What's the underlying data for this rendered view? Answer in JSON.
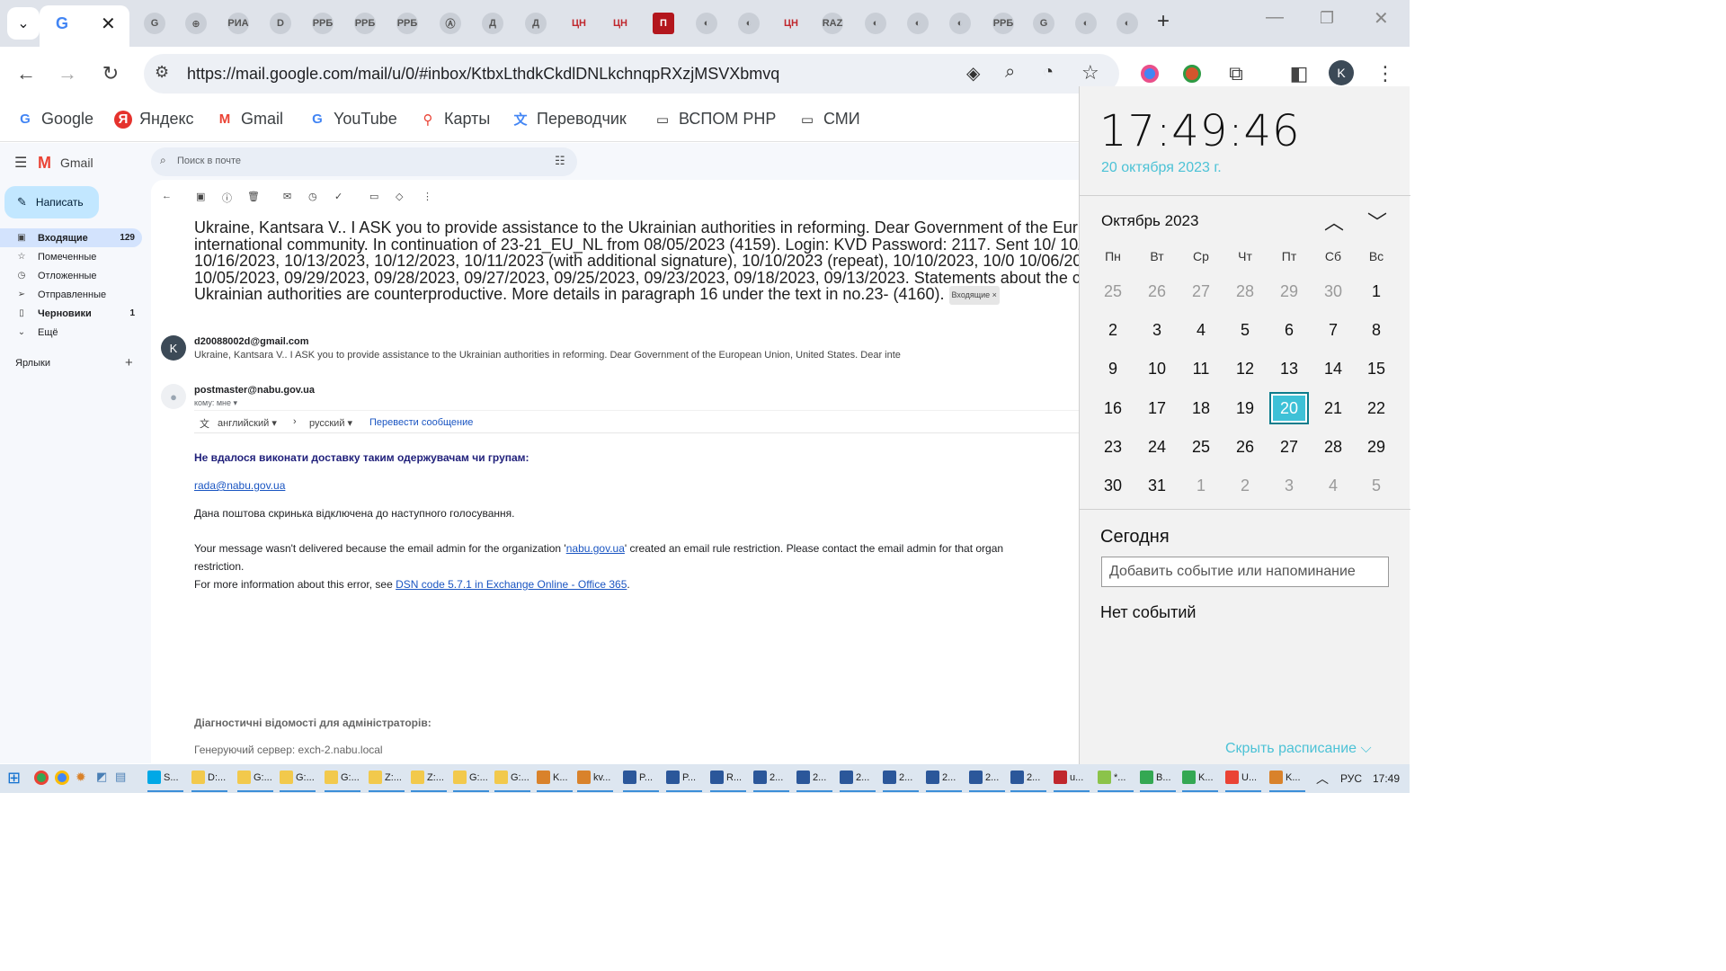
{
  "browser": {
    "tabs": [
      {
        "label": "G",
        "icon": "google-icon"
      },
      {
        "label": "G",
        "icon": "google-icon"
      },
      {
        "label": "⊕",
        "icon": "site-icon"
      },
      {
        "label": "РИА",
        "icon": "ria-icon"
      },
      {
        "label": "D",
        "icon": "d-icon"
      },
      {
        "label": "РРБ",
        "icon": "rrb-icon"
      },
      {
        "label": "РРБ",
        "icon": "rrb-icon"
      },
      {
        "label": "РРБ",
        "icon": "rrb-icon"
      },
      {
        "label": "Ⓐ",
        "icon": "a-icon"
      },
      {
        "label": "Д",
        "icon": "d-circle-icon"
      },
      {
        "label": "Д",
        "icon": "d-circle-icon"
      },
      {
        "label": "ЦН",
        "icon": "cn-icon"
      },
      {
        "label": "ЦН",
        "icon": "cn-icon"
      },
      {
        "label": "П",
        "icon": "p-icon"
      },
      {
        "label": "◐",
        "icon": "globe-icon"
      },
      {
        "label": "◐",
        "icon": "globe-icon"
      },
      {
        "label": "ЦН",
        "icon": "cn-icon"
      },
      {
        "label": "RAZ",
        "icon": "raz-icon"
      },
      {
        "label": "◐",
        "icon": "globe-icon"
      },
      {
        "label": "◐",
        "icon": "globe-icon"
      },
      {
        "label": "◐",
        "icon": "globe-icon"
      },
      {
        "label": "РРБ",
        "icon": "rrb-icon"
      },
      {
        "label": "G",
        "icon": "translate-icon"
      },
      {
        "label": "◐",
        "icon": "globe-icon"
      },
      {
        "label": "◐",
        "icon": "globe-icon"
      }
    ],
    "url": "https://mail.google.com/mail/u/0/#inbox/KtbxLthdkCkdlDNLkchnqpRXzjMSVXbmvq",
    "profile_initial": "K",
    "bookmarks": [
      {
        "label": "Google",
        "icon": "G"
      },
      {
        "label": "Яндекс",
        "icon": "Я"
      },
      {
        "label": "Gmail",
        "icon": "M"
      },
      {
        "label": "YouTube",
        "icon": "G"
      },
      {
        "label": "Карты",
        "icon": "⚲"
      },
      {
        "label": "Переводчик",
        "icon": "文"
      },
      {
        "label": "ВСПОМ PHP",
        "icon": "▭"
      },
      {
        "label": "СМИ",
        "icon": "▭"
      }
    ]
  },
  "gmail": {
    "logo": "Gmail",
    "search_placeholder": "Поиск в почте",
    "compose": "Написать",
    "nav": [
      {
        "label": "Входящие",
        "count": "129",
        "icon": "▣"
      },
      {
        "label": "Помеченные",
        "count": "",
        "icon": "☆"
      },
      {
        "label": "Отложенные",
        "count": "",
        "icon": "◷"
      },
      {
        "label": "Отправленные",
        "count": "",
        "icon": "➢"
      },
      {
        "label": "Черновики",
        "count": "1",
        "icon": "▯"
      },
      {
        "label": "Ещё",
        "count": "",
        "icon": "⌄"
      }
    ],
    "labels_title": "Ярлыки",
    "subject": "Ukraine, Kantsara V.. I ASK you to provide assistance to the Ukrainian authorities in reforming. Dear Government of the Eur Dear international community. In continuation of 23-21_EU_NL from 08/05/2023 (4159). Login: KVD Password: 2117. Sent 10/ 10/17/2023, 10/16/2023, 10/13/2023, 10/12/2023, 10/11/2023 (with additional signature), 10/10/2023 (repeat), 10/10/2023, 10/0 10/06/2023, 10/05/2023, 09/29/2023, 09/28/2023, 09/27/2023, 09/25/2023, 09/23/2023, 09/18/2023, 09/13/2023. Statements about the crimes of the Ukrainian authorities are counterproductive. More details in paragraph 16 under the text in no.23- (4160).",
    "chip": "Входящие ×",
    "msg1": {
      "avatar": "K",
      "sender": "d20088002d@gmail.com",
      "snippet": "Ukraine, Kantsara V.. I ASK you to provide assistance to the Ukrainian authorities in reforming. Dear Government of the European Union, United States. Dear inte"
    },
    "msg2": {
      "sender": "postmaster@nabu.gov.ua",
      "to": "кому: мне ▾",
      "lang_from": "английский ▾",
      "lang_to": "русский ▾",
      "translate": "Перевести сообщение",
      "heading": "Не вдалося виконати доставку таким одержувачам чи групам:",
      "recipient": "rada@nabu.gov.ua",
      "line1": "Дана поштова скринька відключена до наступного голосування.",
      "para_a": "Your message wasn't delivered because the email admin for the organization '",
      "para_link": "nabu.gov.ua",
      "para_b": "' created an email rule restriction. Please contact the email admin for that organ",
      "para_c": "restriction.",
      "info_a": "For more information about this error, see ",
      "info_link": "DSN code 5.7.1 in Exchange Online - Office 365",
      "info_b": ".",
      "diag_title": "Діагностичні відомості для адміністраторів:",
      "diag_server": "Генеруючий сервер: exch-2.nabu.local"
    }
  },
  "calendar": {
    "time": "17:49:46",
    "date": "20 октября 2023 г.",
    "month": "Октябрь 2023",
    "weekdays": [
      "Пн",
      "Вт",
      "Ср",
      "Чт",
      "Пт",
      "Сб",
      "Вс"
    ],
    "days": [
      [
        "25",
        "26",
        "27",
        "28",
        "29",
        "30",
        "1"
      ],
      [
        "2",
        "3",
        "4",
        "5",
        "6",
        "7",
        "8"
      ],
      [
        "9",
        "10",
        "11",
        "12",
        "13",
        "14",
        "15"
      ],
      [
        "16",
        "17",
        "18",
        "19",
        "20",
        "21",
        "22"
      ],
      [
        "23",
        "24",
        "25",
        "26",
        "27",
        "28",
        "29"
      ],
      [
        "30",
        "31",
        "1",
        "2",
        "3",
        "4",
        "5"
      ]
    ],
    "today_heading": "Сегодня",
    "add_event_placeholder": "Добавить событие или напоминание",
    "no_events": "Нет событий",
    "hide_schedule": "Скрыть расписание ⌵"
  },
  "taskbar": {
    "items": [
      {
        "label": "S...",
        "color": "#00a8e6"
      },
      {
        "label": "D:...",
        "color": "#f2c94c"
      },
      {
        "label": "G:...",
        "color": "#f2c94c"
      },
      {
        "label": "G:...",
        "color": "#f2c94c"
      },
      {
        "label": "G:...",
        "color": "#f2c94c"
      },
      {
        "label": "Z:...",
        "color": "#f2c94c"
      },
      {
        "label": "Z:...",
        "color": "#f2c94c"
      },
      {
        "label": "G:...",
        "color": "#f2c94c"
      },
      {
        "label": "G:...",
        "color": "#f2c94c"
      },
      {
        "label": "K...",
        "color": "#d9822b"
      },
      {
        "label": "kv...",
        "color": "#d9822b"
      },
      {
        "label": "P...",
        "color": "#2b579a"
      },
      {
        "label": "P...",
        "color": "#2b579a"
      },
      {
        "label": "R...",
        "color": "#2b579a"
      },
      {
        "label": "2...",
        "color": "#2b579a"
      },
      {
        "label": "2...",
        "color": "#2b579a"
      },
      {
        "label": "2...",
        "color": "#2b579a"
      },
      {
        "label": "2...",
        "color": "#2b579a"
      },
      {
        "label": "2...",
        "color": "#2b579a"
      },
      {
        "label": "2...",
        "color": "#2b579a"
      },
      {
        "label": "2...",
        "color": "#2b579a"
      },
      {
        "label": "u...",
        "color": "#c0272d"
      },
      {
        "label": "*...",
        "color": "#8bc34a"
      },
      {
        "label": "B...",
        "color": "#34a853"
      },
      {
        "label": "K...",
        "color": "#34a853"
      },
      {
        "label": "U...",
        "color": "#ea4335"
      },
      {
        "label": "K...",
        "color": "#d9822b"
      }
    ],
    "lang": "РУС",
    "time": "17:49"
  }
}
